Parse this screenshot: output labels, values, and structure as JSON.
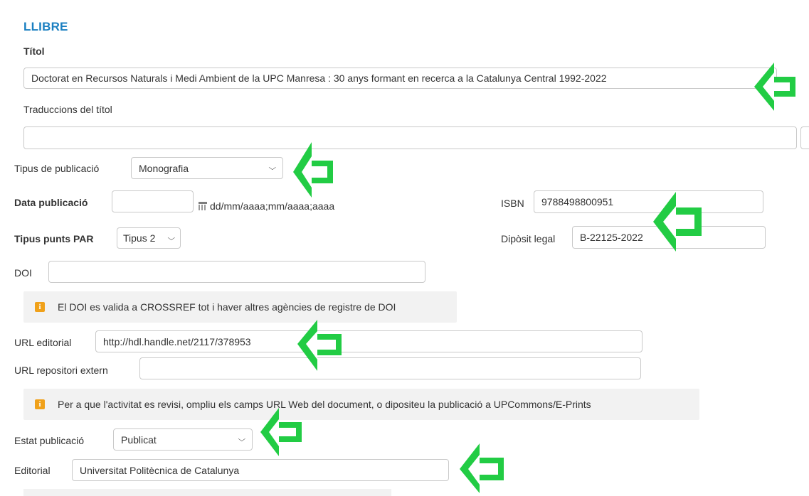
{
  "section": {
    "title": "LLIBRE"
  },
  "titol": {
    "label": "Títol",
    "value": "Doctorat en Recursos Naturals i Medi Ambient de la UPC Manresa : 30 anys formant en recerca a la Catalunya Central 1992-2022"
  },
  "traduccions": {
    "label": "Traduccions del títol",
    "value": ""
  },
  "tipus_publicacio": {
    "label": "Tipus de publicació",
    "value": "Monografia"
  },
  "data_publicacio": {
    "label": "Data publicació",
    "value": "",
    "hint": "dd/mm/aaaa;mm/aaaa;aaaa"
  },
  "isbn": {
    "label": "ISBN",
    "value": "9788498800951"
  },
  "tipus_punts": {
    "label": "Tipus punts PAR",
    "value": "Tipus 2"
  },
  "diposit_legal": {
    "label": "Dipòsit legal",
    "value": "B-22125-2022"
  },
  "doi": {
    "label": "DOI",
    "value": ""
  },
  "doi_info": {
    "text": "El DOI es valida a CROSSREF tot i haver altres agències de registre de DOI"
  },
  "url_editorial": {
    "label": "URL editorial",
    "value": "http://hdl.handle.net/2117/378953"
  },
  "url_repositori": {
    "label": "URL repositori extern",
    "value": ""
  },
  "revisio_info": {
    "text": "Per a que l'activitat es revisi, ompliu els camps URL Web del document, o dipositeu la publicació a UPCommons/E-Prints"
  },
  "estat_publicacio": {
    "label": "Estat publicació",
    "value": "Publicat"
  },
  "editorial": {
    "label": "Editorial",
    "value": "Universitat Politècnica de Catalunya"
  },
  "icons": {
    "info": "info-icon",
    "calendar": "calendar-icon",
    "chevron": "chevron-down-icon",
    "arrow": "green-arrow-left-icon"
  },
  "colors": {
    "accent": "#1a7fc1",
    "arrow": "#22cc44",
    "info_badge": "#f0a11a",
    "info_bg": "#f2f2f2"
  }
}
